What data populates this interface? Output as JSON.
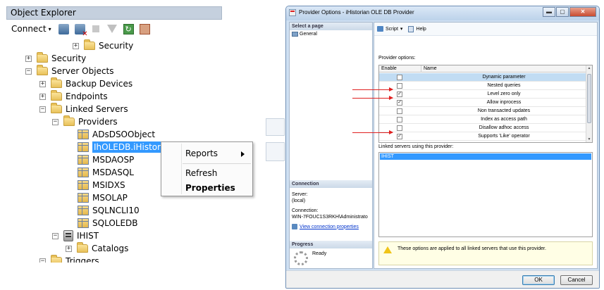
{
  "object_explorer": {
    "title": "Object Explorer",
    "toolbar": {
      "connect_label": "Connect",
      "connect_caret": "▾"
    },
    "tree": [
      {
        "label": "Security",
        "expander": "+"
      },
      {
        "label": "Security",
        "expander": "+"
      },
      {
        "label": "Server Objects",
        "expander": "−"
      },
      {
        "label": "Backup Devices",
        "expander": "+"
      },
      {
        "label": "Endpoints",
        "expander": "+"
      },
      {
        "label": "Linked Servers",
        "expander": "−"
      },
      {
        "label": "Providers",
        "expander": "−"
      },
      {
        "label": "ADsDSOObject"
      },
      {
        "label": "IhOLEDB.iHistorian"
      },
      {
        "label": "MSDAOSP"
      },
      {
        "label": "MSDASQL"
      },
      {
        "label": "MSIDXS"
      },
      {
        "label": "MSOLAP"
      },
      {
        "label": "SQLNCLI10"
      },
      {
        "label": "SQLOLEDB"
      },
      {
        "label": "IHIST",
        "expander": "−"
      },
      {
        "label": "Catalogs",
        "expander": "+"
      },
      {
        "label": "Triggers",
        "expander": "−"
      }
    ]
  },
  "context_menu": {
    "items": [
      {
        "label": "Reports",
        "has_submenu": true
      },
      {
        "label": "Refresh"
      },
      {
        "label": "Properties",
        "bold": true
      }
    ]
  },
  "dialog": {
    "title": "Provider Options - iHistorian OLE DB Provider",
    "window_buttons": {
      "minimize": "▬",
      "maximize": "▢",
      "close": "✕"
    },
    "left": {
      "select_page_header": "Select a page",
      "pages": [
        "General"
      ],
      "connection_header": "Connection",
      "server_label": "Server:",
      "server_value": "(local)",
      "connection_label": "Connection:",
      "connection_value": "WIN-7FOUC1S3RKH\\Administrato",
      "view_link": "View connection properties",
      "progress_header": "Progress",
      "progress_status": "Ready"
    },
    "toolbar": {
      "script_label": "Script",
      "script_caret": "▾",
      "help_label": "Help"
    },
    "provider_options_label": "Provider options:",
    "grid_headers": [
      "Enable",
      "Name"
    ],
    "options": [
      {
        "name": "Dynamic parameter",
        "enabled": false,
        "selected": true
      },
      {
        "name": "Nested queries",
        "enabled": false
      },
      {
        "name": "Level zero only",
        "enabled": true
      },
      {
        "name": "Allow inprocess",
        "enabled": true
      },
      {
        "name": "Non transacted updates",
        "enabled": false
      },
      {
        "name": "Index as access path",
        "enabled": false
      },
      {
        "name": "Disallow adhoc access",
        "enabled": false
      },
      {
        "name": "Supports 'Like' operator",
        "enabled": true
      }
    ],
    "linked_servers_label": "Linked servers using this provider:",
    "linked_servers": [
      "IHIST"
    ],
    "info_message": "These options are applied to all linked servers that use this provider.",
    "ok_label": "OK",
    "cancel_label": "Cancel"
  },
  "colors": {
    "selection": "#3399ff",
    "annotation_arrow": "#e02020",
    "dialog_frame": "#cfe0f2"
  }
}
